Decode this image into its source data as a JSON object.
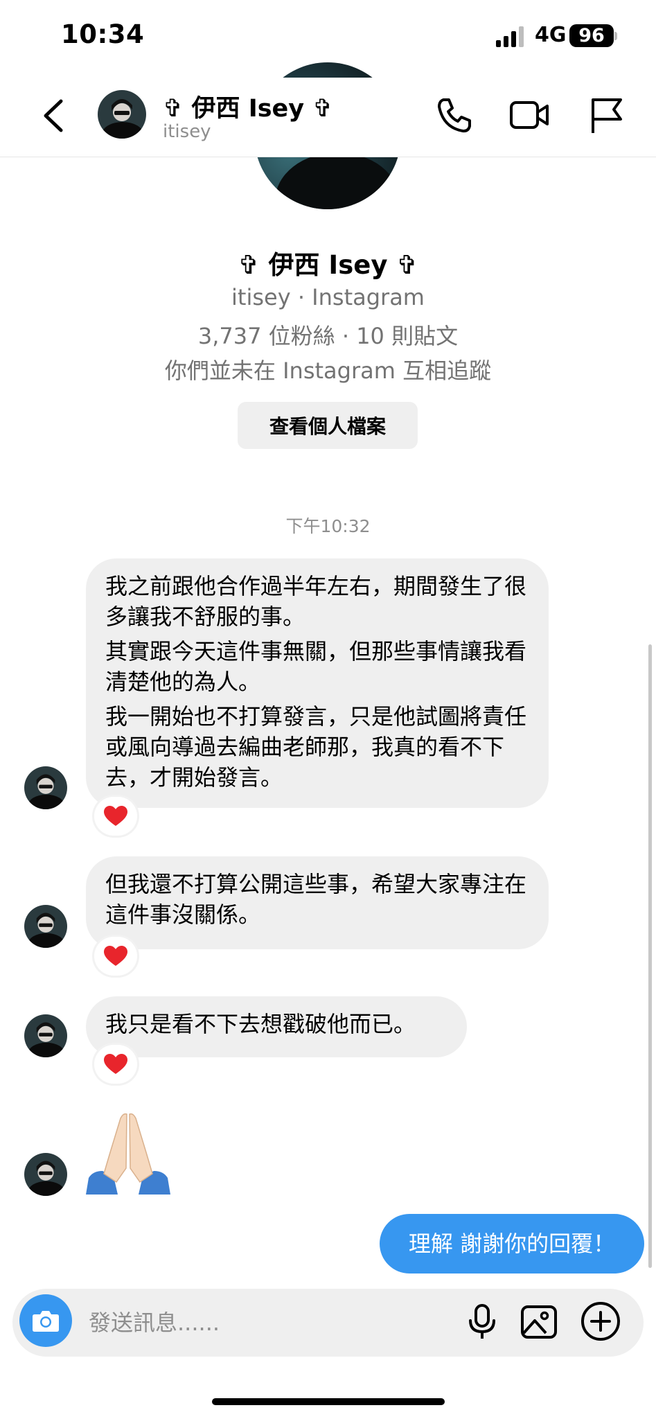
{
  "status_bar": {
    "time": "10:34",
    "network": "4G",
    "battery": "96"
  },
  "header": {
    "name": "✞ 伊西 Isey ✞",
    "username": "itisey"
  },
  "profile": {
    "name": "✞ 伊西 Isey ✞",
    "line1": "itisey · Instagram",
    "line2": "3,737 位粉絲 · 10 則貼文",
    "line3": "你們並未在 Instagram 互相追蹤",
    "button": "查看個人檔案"
  },
  "timestamp": "下午10:32",
  "messages": [
    {
      "lines": [
        "我之前跟他合作過半年左右，期間發生了很多讓我不舒服的事。",
        "其實跟今天這件事無關，但那些事情讓我看清楚他的為人。",
        "我一開始也不打算發言，只是他試圖將責任或風向導過去編曲老師那，我真的看不下去，才開始發言。"
      ],
      "reaction": "heart"
    },
    {
      "lines": [
        "但我還不打算公開這些事，希望大家專注在這件事沒關係。"
      ],
      "reaction": "heart"
    },
    {
      "lines": [
        "我只是看不下去想戳破他而已。"
      ],
      "reaction": "heart"
    },
    {
      "emoji": "praying-hands"
    }
  ],
  "my_message": "理解 謝謝你的回覆！",
  "composer": {
    "placeholder": "發送訊息......"
  },
  "colors": {
    "accent": "#3797f0",
    "bubble_gray": "#efefef",
    "heart": "#e8252c"
  }
}
